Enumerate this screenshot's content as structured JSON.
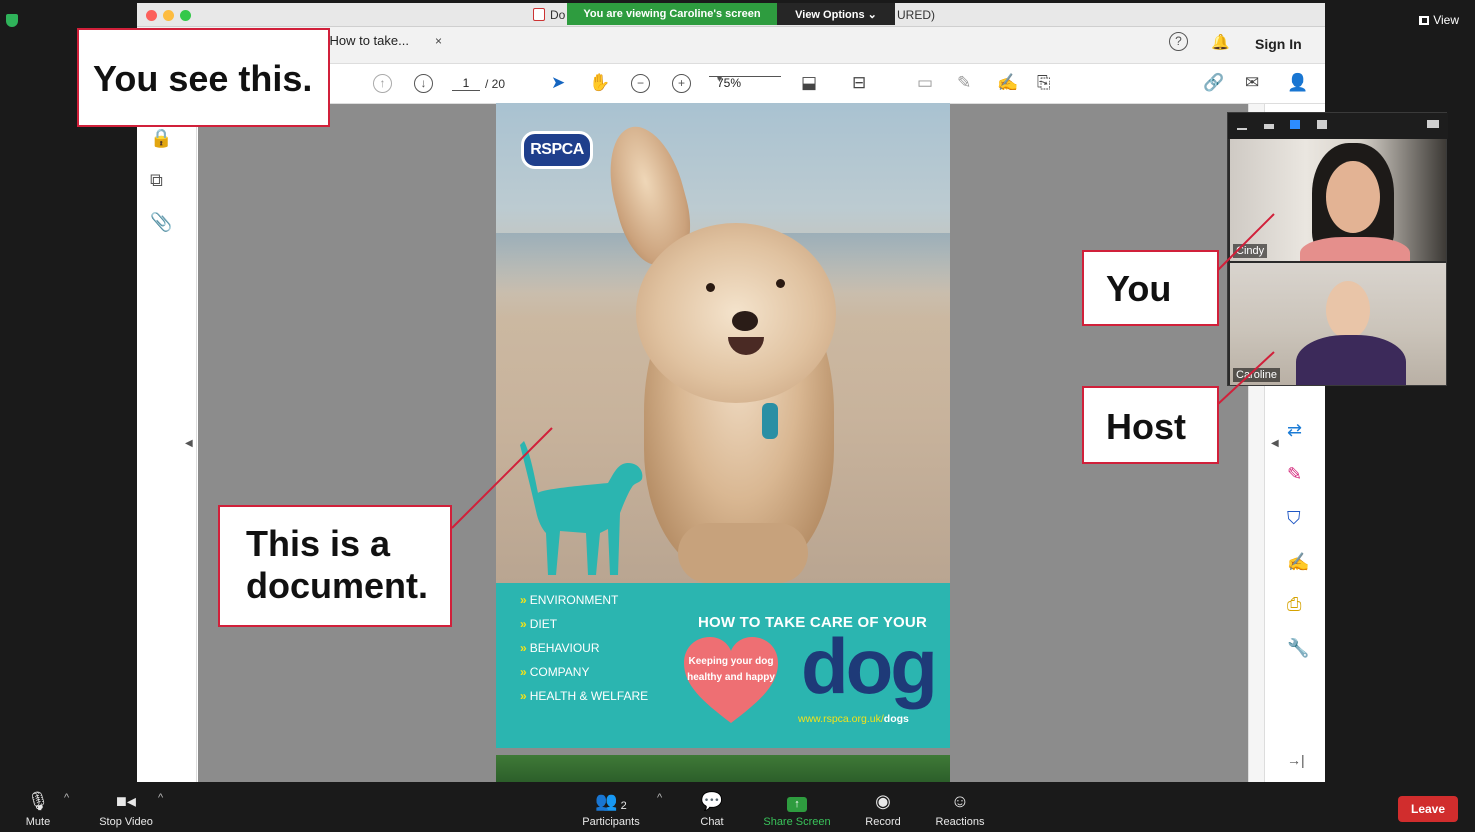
{
  "zoom": {
    "view_label": "View",
    "sharing_banner": "You are viewing Caroline's screen",
    "view_options_label": "View Options ⌄",
    "leave_label": "Leave",
    "bottom_bar": {
      "mute": "Mute",
      "stop_video": "Stop Video",
      "participants": "Participants",
      "participants_count": "2",
      "chat": "Chat",
      "share_screen": "Share Screen",
      "record": "Record",
      "reactions": "Reactions"
    },
    "videos": [
      {
        "name": "Cindy"
      },
      {
        "name": "Caroline"
      }
    ]
  },
  "acrobat": {
    "window_title_left": "Do",
    "window_title_right": "URED)",
    "tab_label": "g_How to take...",
    "tab_close": "×",
    "help": "?",
    "sign_in": "Sign In",
    "page_current": "1",
    "page_total": "/ 20",
    "zoom_level": "75%"
  },
  "document": {
    "logo": "RSPCA",
    "topics": [
      "ENVIRONMENT",
      "DIET",
      "BEHAVIOUR",
      "COMPANY",
      "HEALTH & WELFARE"
    ],
    "headline": "HOW TO TAKE CARE OF YOUR",
    "heart_text": "Keeping your dog healthy and happy",
    "big_word": "dog",
    "url_prefix": "www.rspca.org.uk/",
    "url_suffix": "dogs"
  },
  "annotations": {
    "you_see_this": "You see this.",
    "this_is_a_document_line1": "This is a",
    "this_is_a_document_line2": "document.",
    "you": "You",
    "host": "Host"
  },
  "colors": {
    "accent_red": "#d1203a",
    "teal": "#2bb5b0",
    "navy": "#1e3a78",
    "zoom_green": "#2e9c3f",
    "leave_red": "#d12d2d"
  }
}
